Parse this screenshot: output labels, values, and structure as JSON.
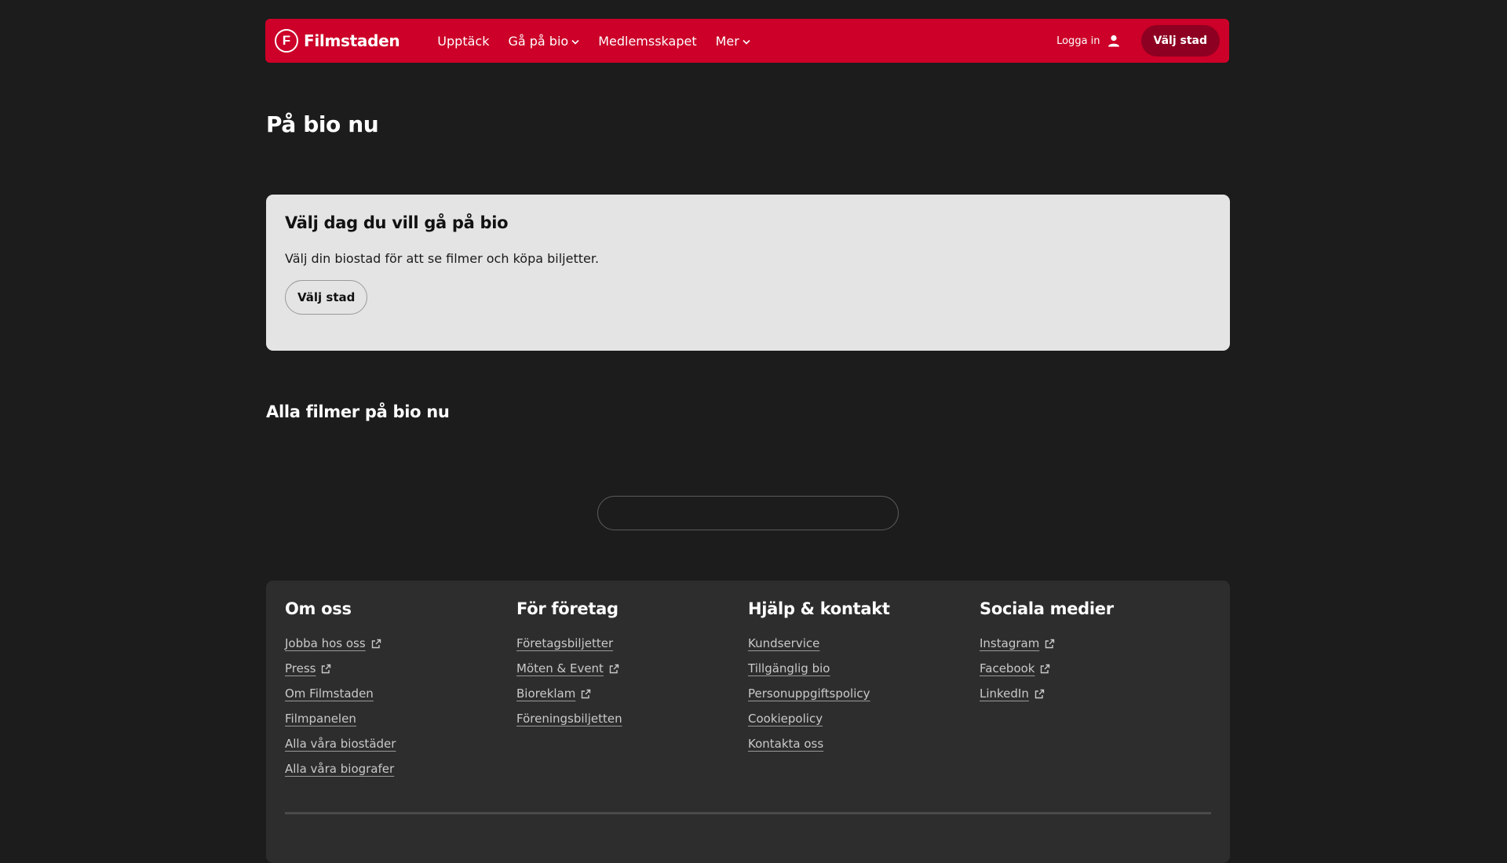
{
  "header": {
    "brand": "Filmstaden",
    "logo_letter": "F",
    "nav": [
      {
        "label": "Upptäck",
        "dropdown": false
      },
      {
        "label": "Gå på bio",
        "dropdown": true
      },
      {
        "label": "Medlemsskapet",
        "dropdown": false
      },
      {
        "label": "Mer",
        "dropdown": true
      }
    ],
    "login_label": "Logga in",
    "city_button": "Välj stad",
    "accent_color": "#cc0028"
  },
  "page": {
    "title": "På bio nu"
  },
  "date_card": {
    "heading": "Välj dag du vill gå på bio",
    "text": "Välj din biostad för att se filmer och köpa biljetter.",
    "button": "Välj stad"
  },
  "movies_section": {
    "title": "Alla filmer på bio nu"
  },
  "footer": {
    "columns": [
      {
        "heading": "Om oss",
        "links": [
          {
            "label": "Jobba hos oss",
            "external": true
          },
          {
            "label": "Press",
            "external": true
          },
          {
            "label": "Om Filmstaden",
            "external": false
          },
          {
            "label": "Filmpanelen",
            "external": false
          },
          {
            "label": "Alla våra biostäder",
            "external": false
          },
          {
            "label": "Alla våra biografer",
            "external": false
          }
        ]
      },
      {
        "heading": "För företag",
        "links": [
          {
            "label": "Företagsbiljetter",
            "external": false
          },
          {
            "label": "Möten & Event",
            "external": true
          },
          {
            "label": "Bioreklam",
            "external": true
          },
          {
            "label": "Föreningsbiljetten",
            "external": false
          }
        ]
      },
      {
        "heading": "Hjälp & kontakt",
        "links": [
          {
            "label": "Kundservice",
            "external": false
          },
          {
            "label": "Tillgänglig bio",
            "external": false
          },
          {
            "label": "Personuppgiftspolicy",
            "external": false
          },
          {
            "label": "Cookiepolicy",
            "external": false
          },
          {
            "label": "Kontakta oss",
            "external": false
          }
        ]
      },
      {
        "heading": "Sociala medier",
        "links": [
          {
            "label": "Instagram",
            "external": true
          },
          {
            "label": "Facebook",
            "external": true
          },
          {
            "label": "LinkedIn",
            "external": true
          }
        ]
      }
    ]
  }
}
